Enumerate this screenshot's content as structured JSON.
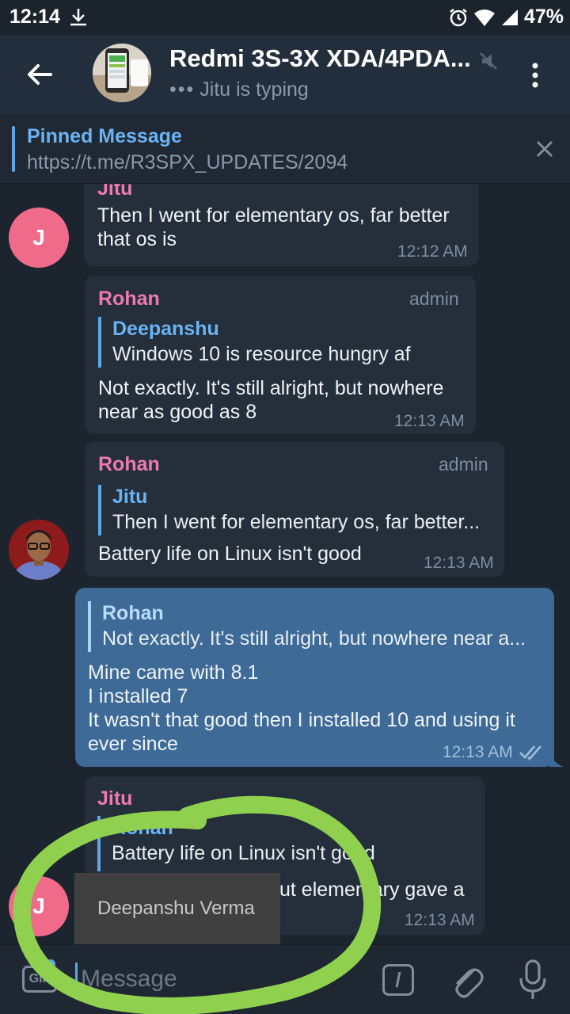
{
  "statusbar": {
    "time": "12:14",
    "battery": "47%"
  },
  "header": {
    "title": "Redmi 3S-3X XDA/4PDA...",
    "subtitle": "Jitu is typing"
  },
  "pinned": {
    "title": "Pinned Message",
    "link": "https://t.me/R3SPX_UPDATES/2094"
  },
  "messages": {
    "m1": {
      "sender": "Jitu",
      "text_1": "Then I went for elementary os, far better",
      "text_2": "that os is",
      "time": "12:12 AM",
      "avatar_letter": "J"
    },
    "m2": {
      "sender": "Rohan",
      "role": "admin",
      "reply_name": "Deepanshu",
      "reply_text": "Windows 10 is resource hungry af",
      "text_1": "Not exactly. It's still alright, but nowhere",
      "text_2": "near as good as 8",
      "time": "12:13 AM"
    },
    "m3": {
      "sender": "Rohan",
      "role": "admin",
      "reply_name": "Jitu",
      "reply_text": "Then I went for elementary os, far better...",
      "text_1": "Battery life on Linux isn't good",
      "time": "12:13 AM"
    },
    "m4": {
      "reply_name": "Rohan",
      "reply_text": "Not exactly. It's still alright, but nowhere near a...",
      "text_1": "Mine came with 8.1",
      "text_2": "I installed 7",
      "text_3": "It wasn't that good then I installed 10 and using it",
      "text_4": "ever since",
      "time": "12:13 AM"
    },
    "m5": {
      "sender": "Jitu",
      "reply_name": "Rohan",
      "reply_text": "Battery life on Linux isn't good",
      "text_1": "ut elementary gave a",
      "time": "12:13 AM",
      "avatar_letter": "J"
    }
  },
  "tooltip": {
    "text": "Deepanshu Verma"
  },
  "input": {
    "gif_label": "GIF",
    "placeholder": "Message",
    "command_label": "/"
  },
  "colors": {
    "accent": "#5ea7e6",
    "sender_pink": "#ee7aae",
    "annotation_green": "#8fd14f"
  }
}
